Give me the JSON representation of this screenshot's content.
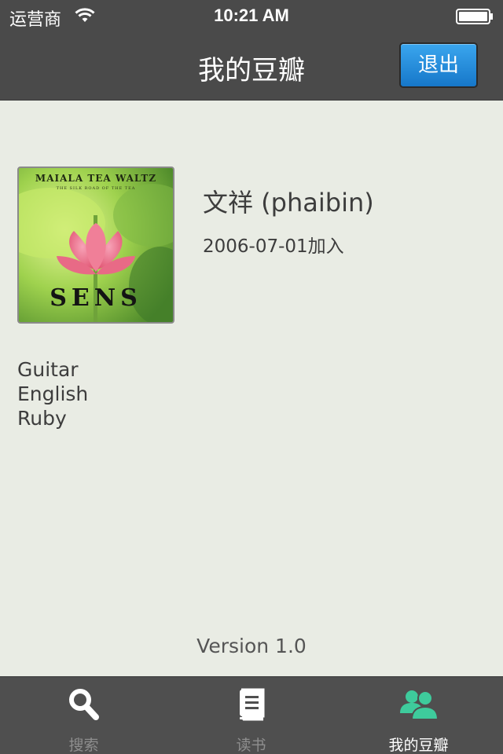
{
  "status_bar": {
    "carrier": "运营商",
    "time": "10:21 AM"
  },
  "nav": {
    "title": "我的豆瓣",
    "logout_label": "退出"
  },
  "profile": {
    "avatar": {
      "album_title": "MAIALA TEA WALTZ",
      "album_subtitle": "THE SILK ROAD OF THE TEA",
      "album_name": "SENS"
    },
    "name": "文祥 (phaibin)",
    "joined": "2006-07-01加入",
    "tags": [
      "Guitar",
      "English",
      "Ruby"
    ]
  },
  "footer": {
    "version": "Version 1.0"
  },
  "tabs": [
    {
      "label": "搜索",
      "icon": "search-icon",
      "active": false
    },
    {
      "label": "读书",
      "icon": "book-icon",
      "active": false
    },
    {
      "label": "我的豆瓣",
      "icon": "people-icon",
      "active": true
    }
  ],
  "colors": {
    "background": "#e9ece4",
    "bar": "#4a4a4a",
    "accent_button": "#1f8ad9",
    "active_tab_icon": "#3ecb9c",
    "inactive_tab_icon": "#ffffff"
  }
}
